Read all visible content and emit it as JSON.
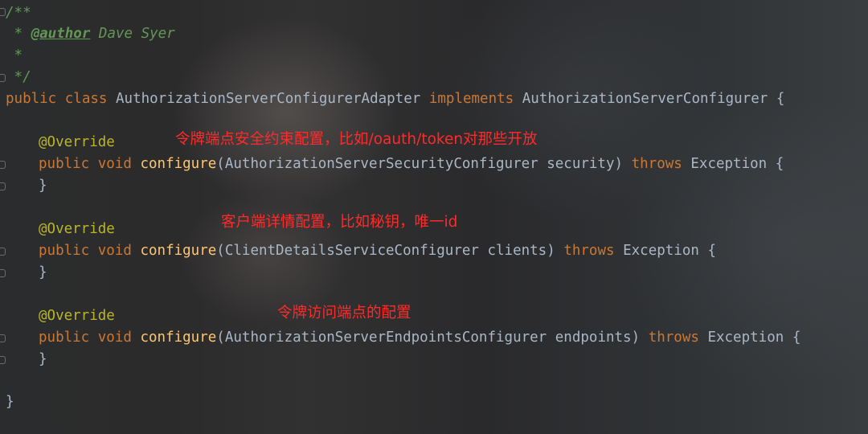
{
  "editor": {
    "colors": {
      "background": "#2b2b2b",
      "keyword": "#cc7832",
      "annotation": "#bbb529",
      "method": "#ffc66d",
      "comment": "#629755",
      "text": "#a9b7c6",
      "note": "#ff2a2a"
    },
    "doc_comment": {
      "open": "/**",
      "star": " * ",
      "author_tag": "@author",
      "author_name": " Dave Syer",
      "empty": " *",
      "close": " */"
    },
    "class_decl": {
      "public": "public",
      "class_kw": "class",
      "name": "AuthorizationServerConfigurerAdapter",
      "implements": "implements",
      "interface": "AuthorizationServerConfigurer",
      "brace": "{"
    },
    "override": "@Override",
    "public_kw": "public",
    "void_kw": "void",
    "method_name": "configure",
    "throws_kw": "throws",
    "exception": "Exception",
    "open_brace": "{",
    "close_brace": "}",
    "methods": [
      {
        "paren_open": "(",
        "param_type": "AuthorizationServerSecurityConfigurer",
        "param_name": "security",
        "paren_close": ")"
      },
      {
        "paren_open": "(",
        "param_type": "ClientDetailsServiceConfigurer",
        "param_name": "clients",
        "paren_close": ")"
      },
      {
        "paren_open": "(",
        "param_type": "AuthorizationServerEndpointsConfigurer",
        "param_name": "endpoints",
        "paren_close": ")"
      }
    ],
    "class_close": "}"
  },
  "annotations": [
    "令牌端点安全约束配置，比如/oauth/token对那些开放",
    "客户端详情配置，比如秘钥，唯一id",
    "令牌访问端点的配置"
  ]
}
